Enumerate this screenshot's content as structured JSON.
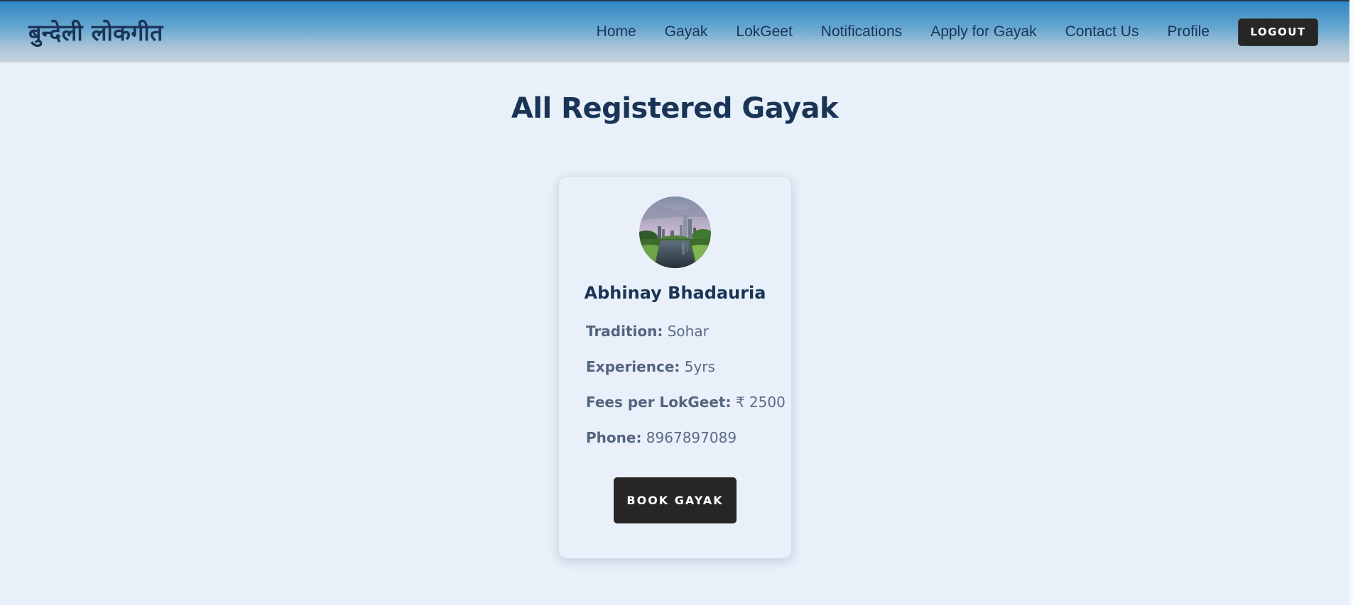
{
  "brand": {
    "title": "बुन्देली लोकगीत"
  },
  "nav": {
    "items": [
      {
        "label": "Home"
      },
      {
        "label": "Gayak"
      },
      {
        "label": "LokGeet"
      },
      {
        "label": "Notifications"
      },
      {
        "label": "Apply for Gayak"
      },
      {
        "label": "Contact Us"
      },
      {
        "label": "Profile"
      }
    ],
    "logout_label": "LOGOUT"
  },
  "page": {
    "title": "All Registered Gayak"
  },
  "gayak_cards": [
    {
      "name": "Abhinay Bhadauria",
      "avatar_icon": "city-park-photo",
      "tradition_label": "Tradition:",
      "tradition": "Sohar",
      "experience_label": "Experience:",
      "experience": "5yrs",
      "fees_label": "Fees per LokGeet:",
      "fees": "₹ 2500",
      "phone_label": "Phone:",
      "phone": "8967897089",
      "book_label": "BOOK GAYAK"
    }
  ],
  "colors": {
    "background": "#e8f0f9",
    "heading": "#1a3456",
    "button_dark": "#282624",
    "nav_gradient_top": "#2f86c2",
    "nav_gradient_bottom": "#c4d3dd"
  }
}
